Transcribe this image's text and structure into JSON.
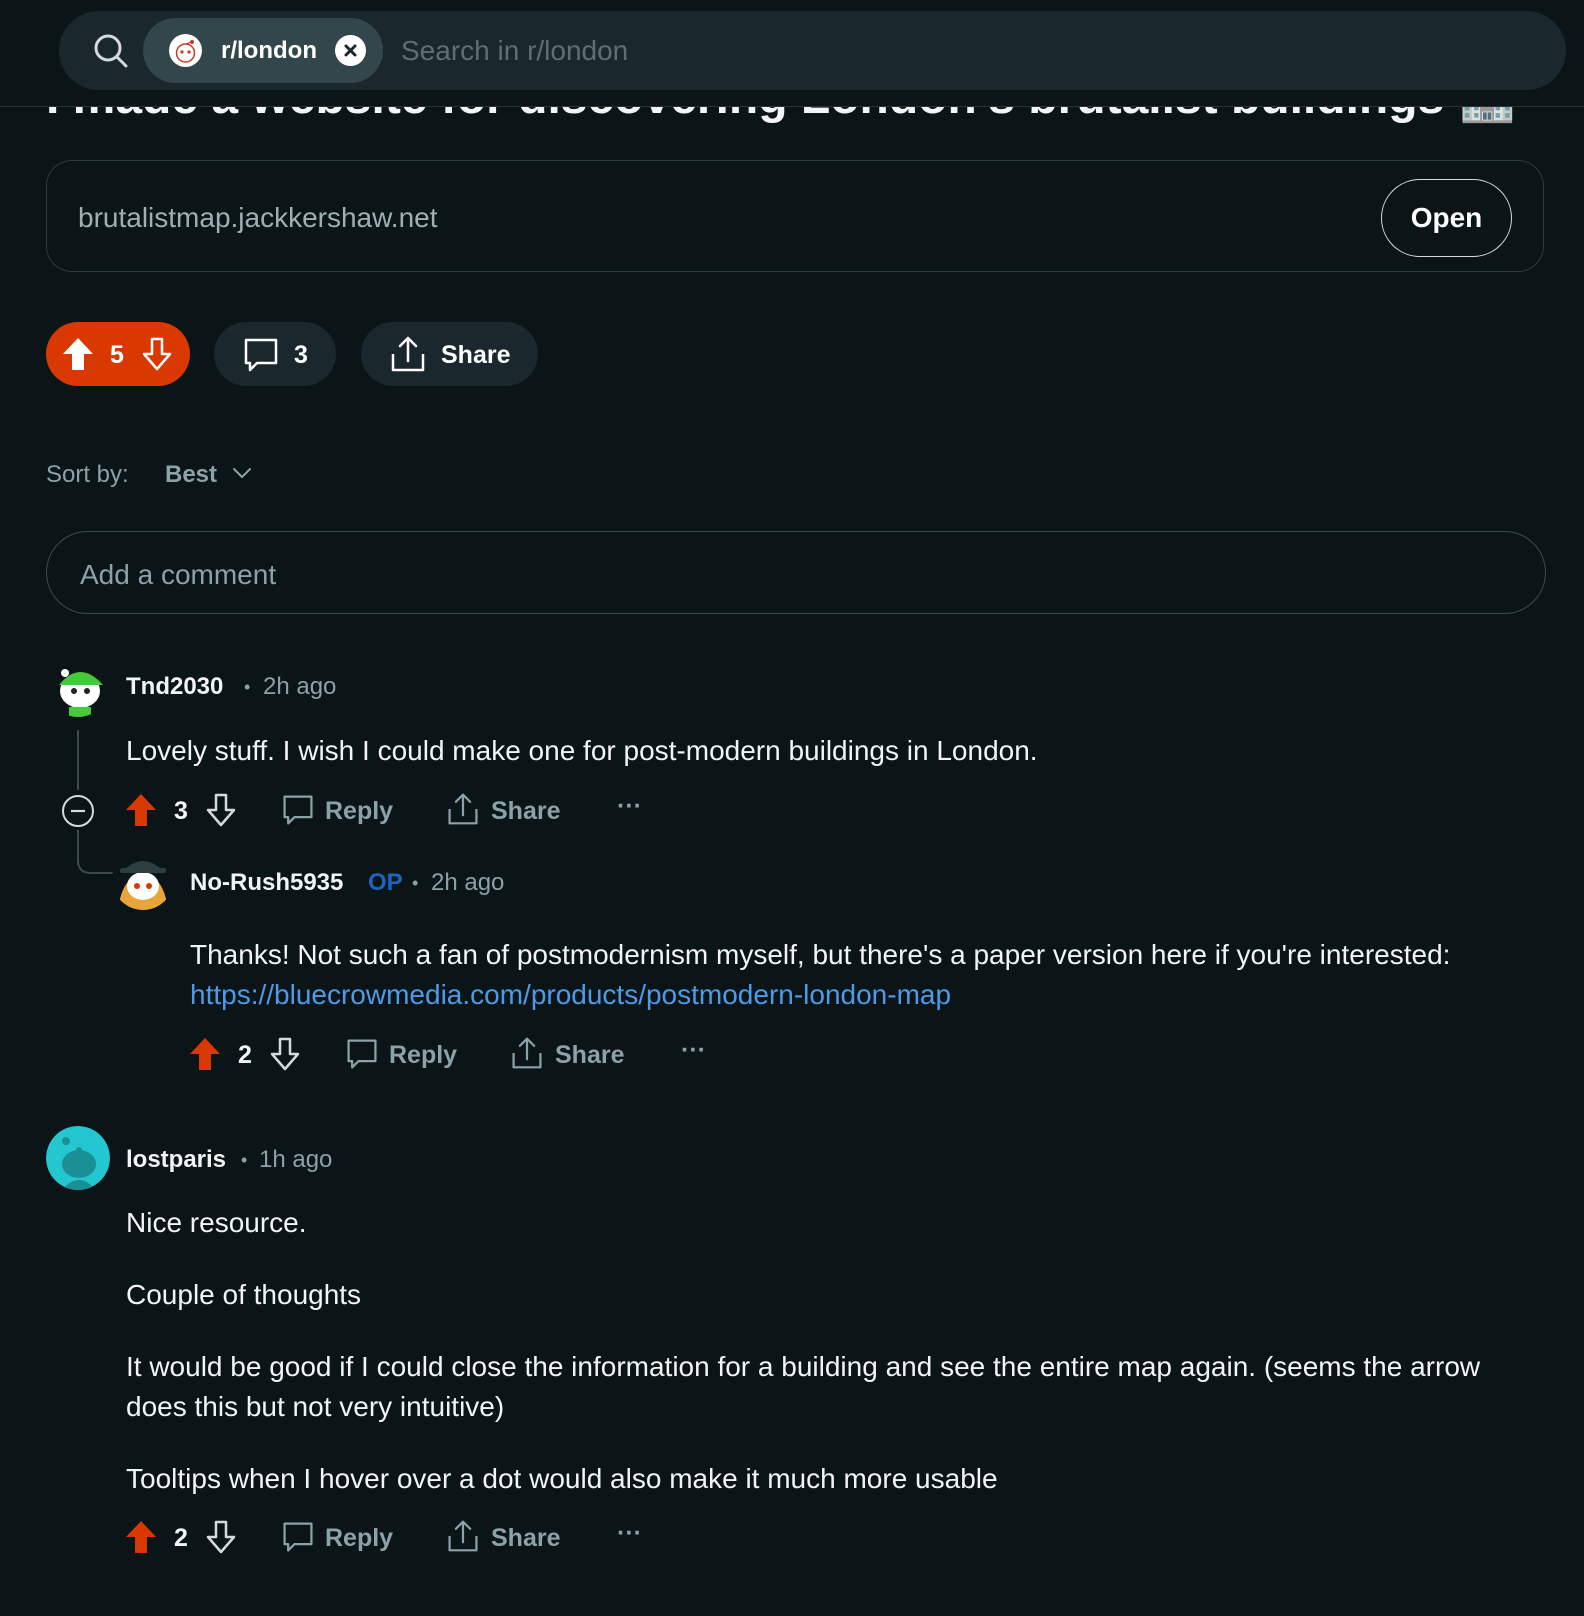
{
  "search": {
    "community": "r/london",
    "placeholder": "Search in r/london"
  },
  "post": {
    "title": "I made a website for discovering London's brutalist buildings 🏢",
    "link_domain": "brutalistmap.jackkershaw.net",
    "open_label": "Open",
    "score": "5",
    "comment_count": "3",
    "share_label": "Share"
  },
  "sort": {
    "label": "Sort by:",
    "value": "Best"
  },
  "add_comment_placeholder": "Add a comment",
  "comments": [
    {
      "user": "Tnd2030",
      "dot": "•",
      "time": "2h ago",
      "body": "Lovely stuff. I wish I could make one for post-modern buildings in London.",
      "score": "3",
      "reply_label": "Reply",
      "share_label": "Share",
      "more": "···",
      "replies": [
        {
          "user": "No-Rush5935",
          "badge": "OP",
          "dot": "•",
          "time": "2h ago",
          "body": "Thanks! Not such a fan of postmodernism myself, but there's a paper version here if you're interested:",
          "link": "https://bluecrowmedia.com/products/postmodern-london-map",
          "score": "2",
          "reply_label": "Reply",
          "share_label": "Share",
          "more": "···"
        }
      ]
    },
    {
      "user": "lostparis",
      "dot": "•",
      "time": "1h ago",
      "paragraphs": [
        "Nice resource.",
        "Couple of thoughts",
        "It would be good if I could close the information for a building and see the entire map again. (seems the arrow does this but not very intuitive)",
        "Tooltips when I hover over a dot would also make it much more usable"
      ],
      "score": "2",
      "reply_label": "Reply",
      "share_label": "Share",
      "more": "···"
    }
  ],
  "colors": {
    "background": "#0b1416",
    "upvote": "#d93900",
    "link": "#4f9ae8",
    "op_badge": "#1c64c4"
  }
}
